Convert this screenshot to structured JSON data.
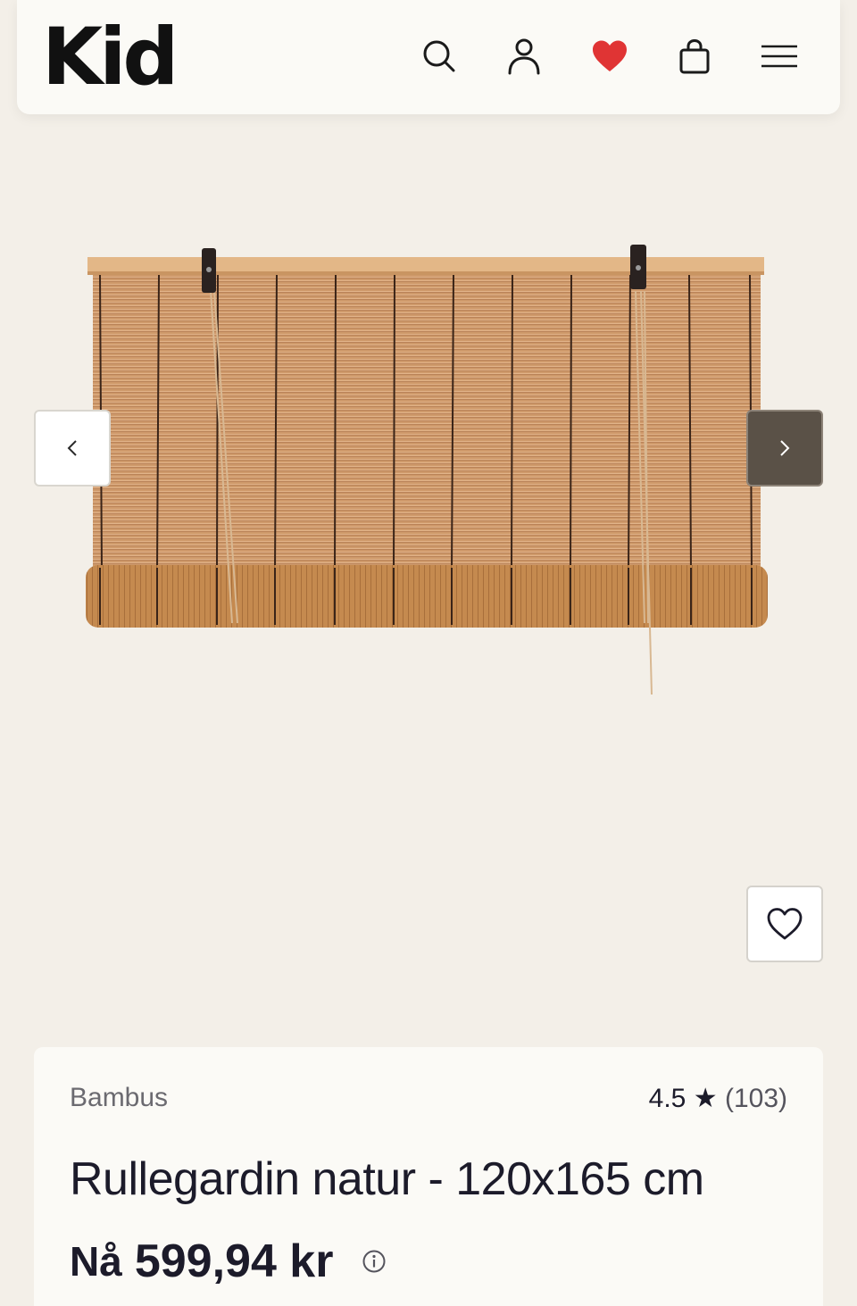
{
  "header": {
    "logo": "Kid",
    "icons": [
      "search-icon",
      "account-icon",
      "heart-icon",
      "bag-icon",
      "menu-icon"
    ],
    "heart_color": "#e03434"
  },
  "gallery": {
    "prev_arrow": "‹",
    "next_arrow": "›"
  },
  "product": {
    "brand": "Bambus",
    "rating_value": "4.5",
    "rating_star": "★",
    "rating_count": "(103)",
    "title": "Rullegardin natur - 120x165 cm",
    "price_prefix": "Nå",
    "price": "599,94 kr"
  }
}
